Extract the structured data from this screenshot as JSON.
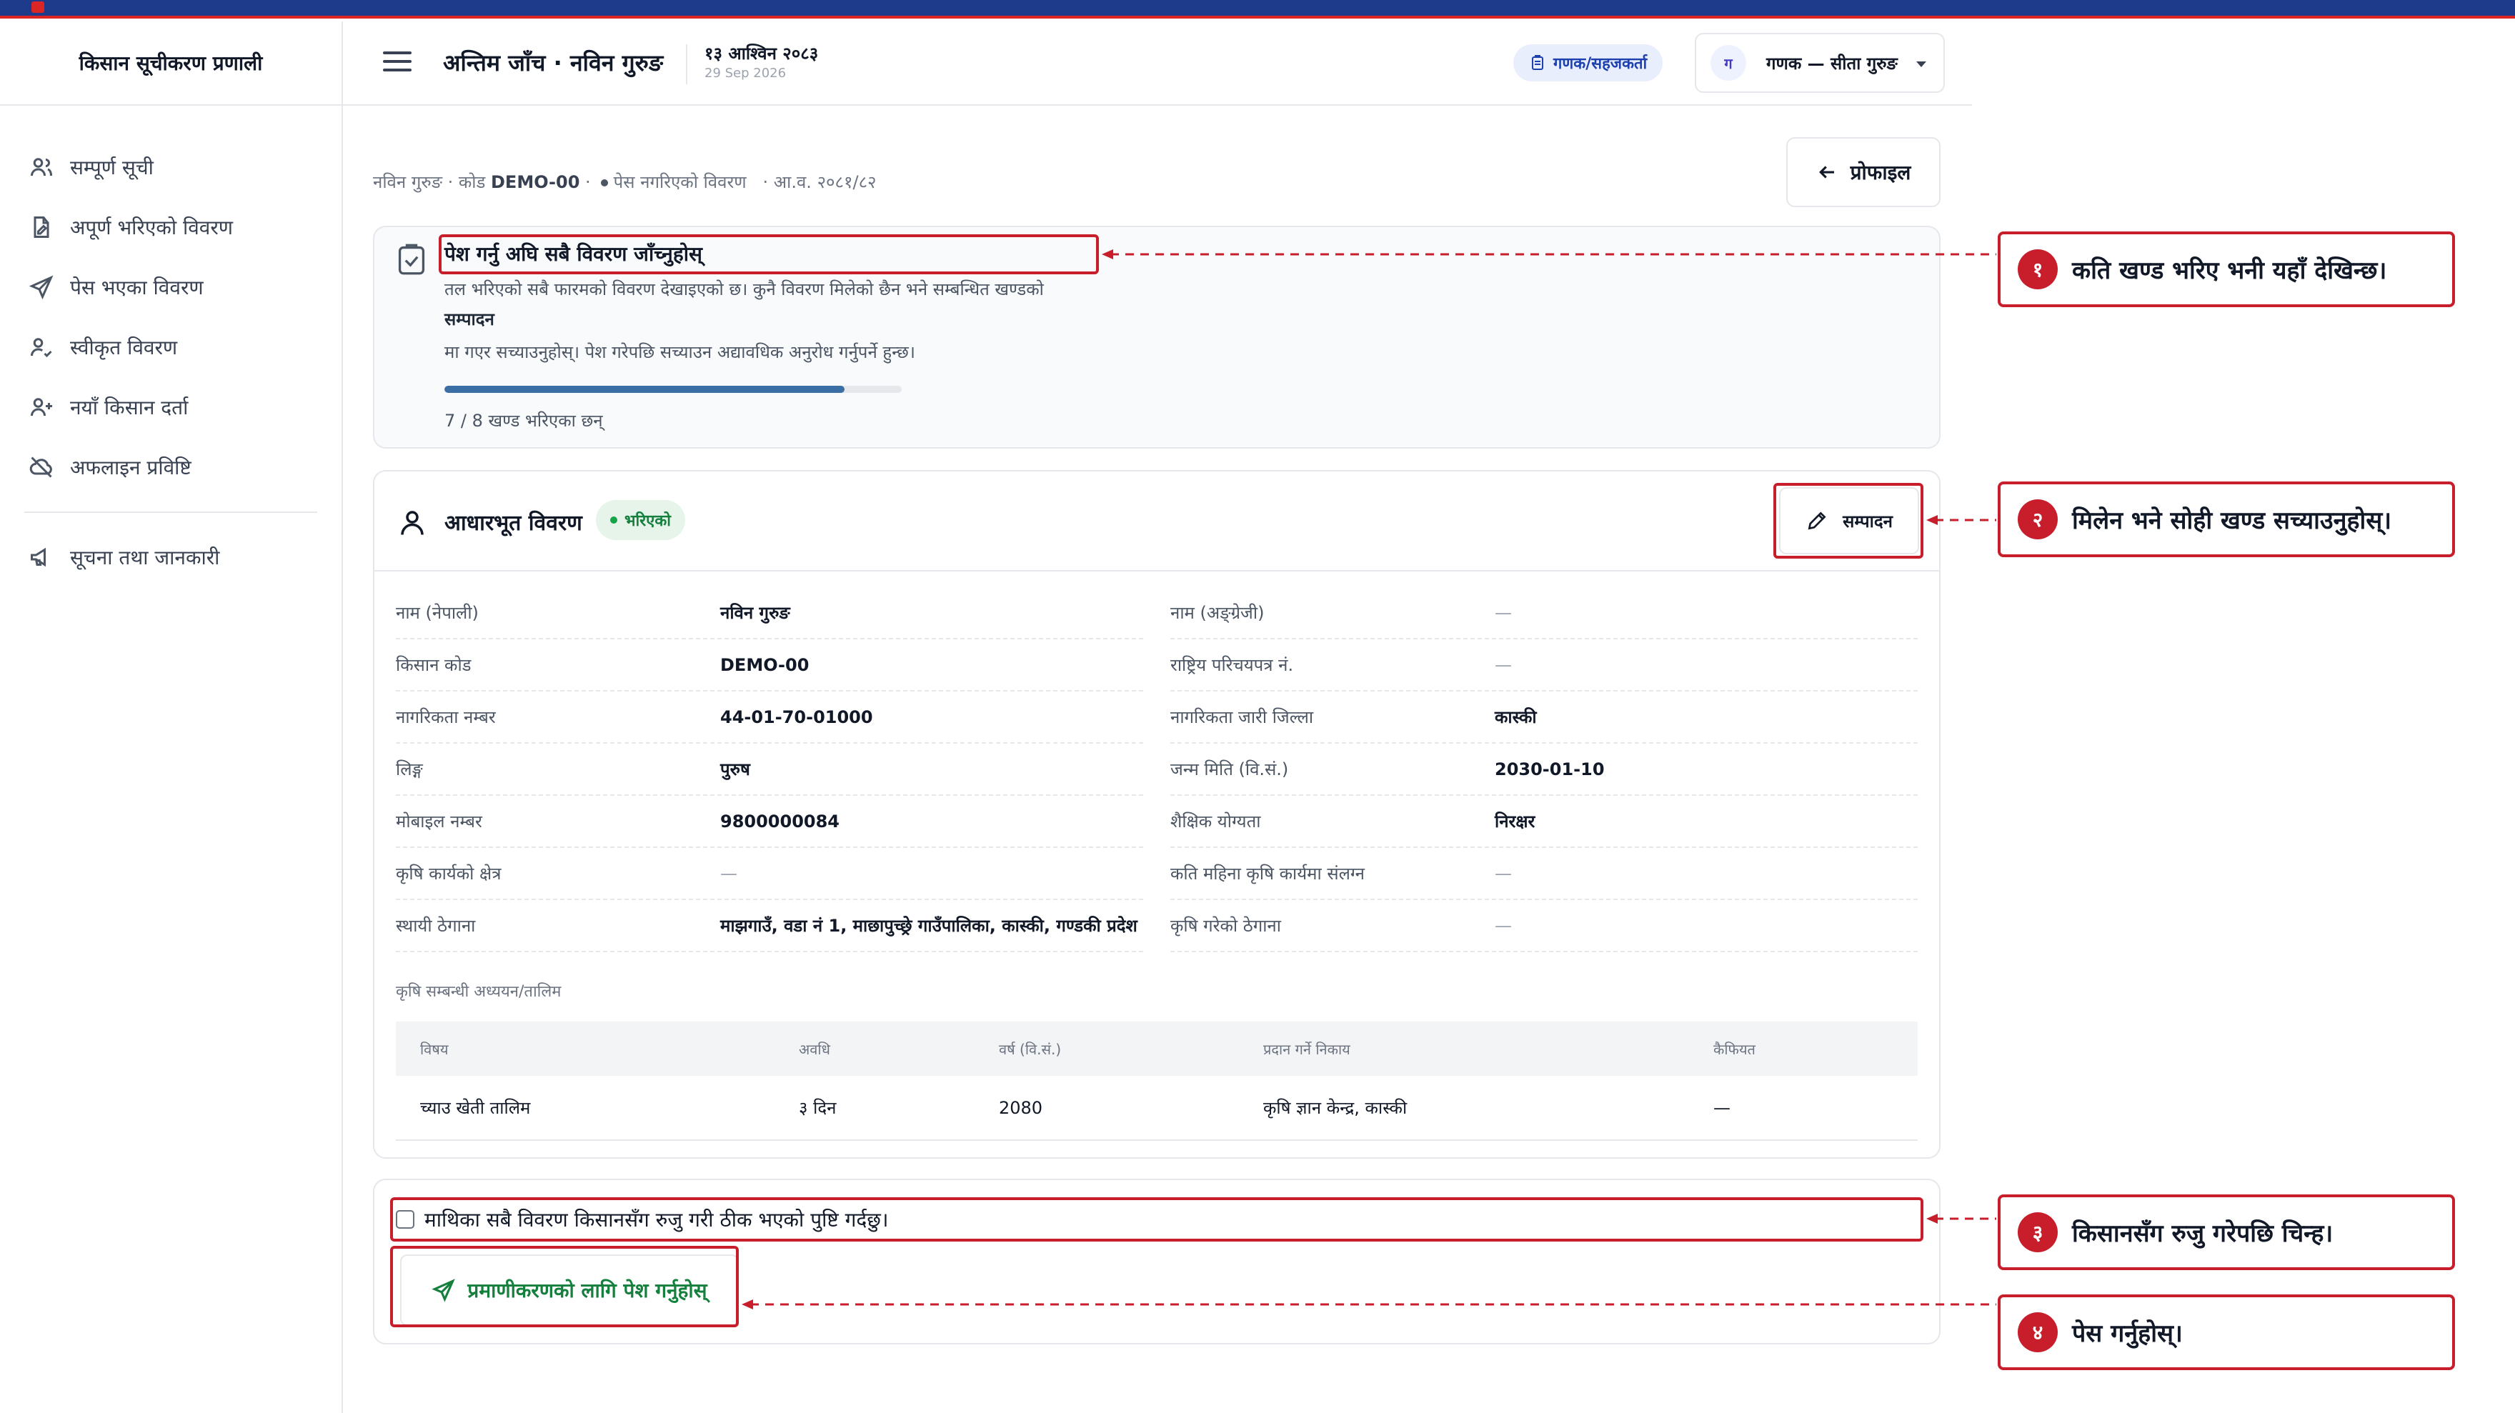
{
  "sidebar": {
    "brand": "किसान सूचीकरण प्रणाली",
    "items": [
      {
        "label": "सम्पूर्ण सूची",
        "icon": "users-icon"
      },
      {
        "label": "अपूर्ण भरिएको विवरण",
        "icon": "document-edit-icon"
      },
      {
        "label": "पेस भएका विवरण",
        "icon": "send-icon"
      },
      {
        "label": "स्वीकृत विवरण",
        "icon": "user-check-icon"
      },
      {
        "label": "नयाँ किसान दर्ता",
        "icon": "user-plus-icon"
      },
      {
        "label": "अफलाइन प्रविष्टि",
        "icon": "cloud-off-icon"
      },
      {
        "label": "सूचना तथा जानकारी",
        "icon": "megaphone-icon"
      }
    ]
  },
  "header": {
    "title": "अन्तिम जाँच · नविन गुरुङ",
    "date_np": "१३ आश्विन २०८३",
    "date_en": "29 Sep 2026",
    "role_label": "गणक/सहजकर्ता",
    "user_initial": "ग",
    "user_name": "गणक — सीता गुरुङ"
  },
  "breadcrumb": {
    "prefix": "नविन गुरुङ · कोड",
    "code": "DEMO-00",
    "sep": " ·",
    "status": "पेस नगरिएको विवरण",
    "fiscal_year": "· आ.व. २०८१/८२"
  },
  "profile_button": "प्रोफाइल",
  "check_card": {
    "title": "पेश गर्नु अघि सबै विवरण जाँच्नुहोस्",
    "description": "तल भरिएको सबै फारमको विवरण देखाइएको छ। कुनै विवरण मिलेको छैन भने सम्बन्धित खण्डको",
    "description_bold": "सम्पादन",
    "description_2": "मा गएर सच्याउनुहोस्। पेश गरेपछि सच्याउन अद्यावधिक अनुरोध गर्नुपर्ने हुन्छ।",
    "progress_fraction": 0.875,
    "progress_label": "7 / 8 खण्ड भरिएका छन्"
  },
  "basic_card": {
    "title": "आधारभूत विवरण",
    "status": "भरिएको",
    "edit_label": "सम्पादन",
    "rows": [
      [
        {
          "label": "नाम (नेपाली)",
          "value": "नविन गुरुङ"
        },
        {
          "label": "नाम (अङ्ग्रेजी)",
          "value": "—"
        }
      ],
      [
        {
          "label": "किसान कोड",
          "value": "DEMO-00"
        },
        {
          "label": "राष्ट्रिय परिचयपत्र नं.",
          "value": "—"
        }
      ],
      [
        {
          "label": "नागरिकता नम्बर",
          "value": "44-01-70-01000"
        },
        {
          "label": "नागरिकता जारी जिल्ला",
          "value": "कास्की"
        }
      ],
      [
        {
          "label": "लिङ्ग",
          "value": "पुरुष"
        },
        {
          "label": "जन्म मिति (वि.सं.)",
          "value": "2030-01-10"
        }
      ],
      [
        {
          "label": "मोबाइल नम्बर",
          "value": "9800000084"
        },
        {
          "label": "शैक्षिक योग्यता",
          "value": "निरक्षर"
        }
      ],
      [
        {
          "label": "कृषि कार्यको क्षेत्र",
          "value": "—"
        },
        {
          "label": "कति महिना कृषि कार्यमा संलग्न",
          "value": "—"
        }
      ],
      [
        {
          "label": "स्थायी ठेगाना",
          "value": "माझगाउँ, वडा नं 1, माछापुच्छ्रे गाउँपालिका, कास्की, गण्डकी प्रदेश"
        },
        {
          "label": "कृषि गरेको ठेगाना",
          "value": "—"
        }
      ]
    ],
    "training_title": "कृषि सम्बन्धी अध्ययन/तालिम",
    "training_headers": [
      "विषय",
      "अवधि",
      "वर्ष (वि.सं.)",
      "प्रदान गर्ने निकाय",
      "कैफियत"
    ],
    "training_rows": [
      [
        "च्याउ खेती तालिम",
        "३ दिन",
        "2080",
        "कृषि ज्ञान केन्द्र, कास्की",
        "—"
      ]
    ]
  },
  "submit_card": {
    "confirm_text": "माथिका सबै विवरण किसानसँग रुजु गरी ठीक भएको पुष्टि गर्दछु।",
    "submit_label": "प्रमाणीकरणको लागि पेश गर्नुहोस्"
  },
  "annotations": [
    {
      "num": "१",
      "text": "कति खण्ड भरिए भनी यहाँ देखिन्छ।"
    },
    {
      "num": "२",
      "text": "मिलेन भने सोही खण्ड सच्याउनुहोस्।"
    },
    {
      "num": "३",
      "text": "किसानसँग रुजु गरेपछि चिन्ह।"
    },
    {
      "num": "४",
      "text": "पेस गर्नुहोस्।"
    }
  ],
  "colors": {
    "accent": "#1e3a8a",
    "annotation": "#c81e2b",
    "success": "#15803d",
    "progress": "#3b6ea5"
  }
}
